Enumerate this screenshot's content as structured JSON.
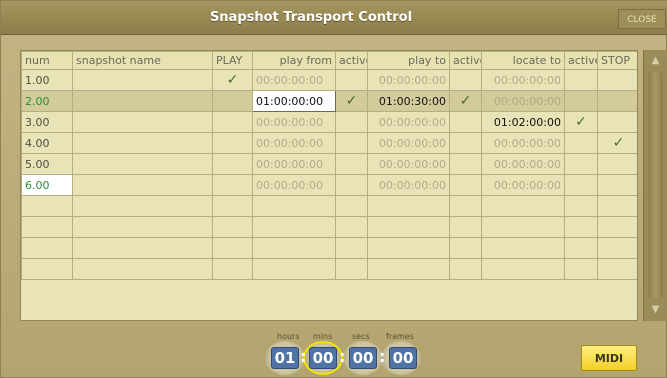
{
  "window": {
    "title": "Snapshot Transport Control",
    "close_label": "CLOSE"
  },
  "table": {
    "headers": [
      "num",
      "snapshot name",
      "PLAY",
      "play from",
      "active",
      "play to",
      "active",
      "locate to",
      "active",
      "STOP"
    ],
    "rows": [
      {
        "num": "1.00",
        "name": "",
        "play": true,
        "play_from": "00:00:00:00",
        "active1": false,
        "play_to": "00:00:00:00",
        "active2": false,
        "locate_to": "00:00:00:00",
        "active3": false,
        "stop": false
      },
      {
        "num": "2.00",
        "name": "",
        "play": false,
        "play_from": "01:00:00:00",
        "active1": true,
        "play_to": "01:00:30:00",
        "active2": true,
        "locate_to": "00:00:00:00",
        "active3": false,
        "stop": false
      },
      {
        "num": "3.00",
        "name": "",
        "play": false,
        "play_from": "00:00:00:00",
        "active1": false,
        "play_to": "00:00:00:00",
        "active2": false,
        "locate_to": "01:02:00:00",
        "active3": true,
        "stop": false
      },
      {
        "num": "4.00",
        "name": "",
        "play": false,
        "play_from": "00:00:00:00",
        "active1": false,
        "play_to": "00:00:00:00",
        "active2": false,
        "locate_to": "00:00:00:00",
        "active3": false,
        "stop": true
      },
      {
        "num": "5.00",
        "name": "",
        "play": false,
        "play_from": "00:00:00:00",
        "active1": false,
        "play_to": "00:00:00:00",
        "active2": false,
        "locate_to": "00:00:00:00",
        "active3": false,
        "stop": false
      },
      {
        "num": "6.00",
        "name": "",
        "play": false,
        "play_from": "00:00:00:00",
        "active1": false,
        "play_to": "00:00:00:00",
        "active2": false,
        "locate_to": "00:00:00:00",
        "active3": false,
        "stop": false
      }
    ],
    "check_glyph": "✓"
  },
  "timecode": {
    "labels": {
      "hours": "hours",
      "mins": "mins",
      "secs": "secs",
      "frames": "frames"
    },
    "hours": "01",
    "mins": "00",
    "secs": "00",
    "frames": "00",
    "separator": ":"
  },
  "midi_label": "MIDI",
  "icons": {
    "scroll_up": "scroll-up-arrow-icon",
    "scroll_down": "scroll-down-arrow-icon"
  },
  "colors": {
    "accent_highlight": "#f1e200",
    "timecode_field": "#4f73a5"
  }
}
